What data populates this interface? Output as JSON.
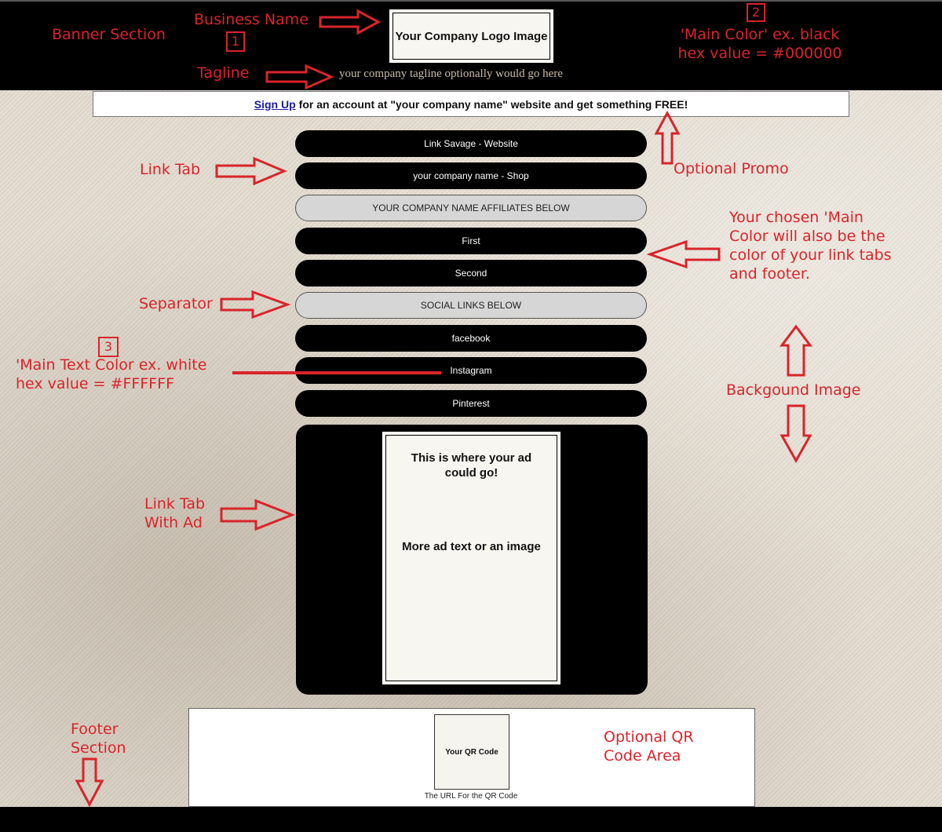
{
  "banner": {
    "logo_text": "Your Company Logo Image",
    "tagline": "your company tagline optionally would go here"
  },
  "promo": {
    "link_label": "Sign Up",
    "text": "for an account at \"your company name\" website and get something FREE!"
  },
  "link_tabs": [
    {
      "label": "Link Savage - Website",
      "type": "link"
    },
    {
      "label": "your company name - Shop",
      "type": "link"
    },
    {
      "label": "YOUR COMPANY NAME AFFILIATES BELOW",
      "type": "separator"
    },
    {
      "label": "First",
      "type": "link"
    },
    {
      "label": "Second",
      "type": "link"
    },
    {
      "label": "SOCIAL LINKS BELOW",
      "type": "separator"
    },
    {
      "label": "facebook",
      "type": "link"
    },
    {
      "label": "Instagram",
      "type": "link"
    },
    {
      "label": "Pinterest",
      "type": "link"
    }
  ],
  "ad": {
    "line1": "This is where your ad could go!",
    "line2": "More ad text or an image"
  },
  "footer": {
    "qr_label": "Your QR Code",
    "qr_url": "The URL For the QR Code"
  },
  "colors": {
    "main_color": "#000000",
    "main_text_color": "#FFFFFF",
    "annotation_color": "#d9242b"
  },
  "annotations": {
    "banner_section": "Banner Section",
    "business_name": "Business Name",
    "num1": "1",
    "tagline": "Tagline",
    "num2": "2",
    "main_color_line1": "'Main Color' ex. black",
    "main_color_line2": "hex value = #000000",
    "optional_promo": "Optional Promo",
    "link_tab": "Link Tab",
    "chosen_color_line1": "Your chosen 'Main",
    "chosen_color_line2": "Color will also be the",
    "chosen_color_line3": "color of your link tabs",
    "chosen_color_line4": "and footer.",
    "separator": "Separator",
    "num3": "3",
    "main_text_line1": "'Main Text Color ex. white",
    "main_text_line2": "hex value = #FFFFFF",
    "background_image": "Backgound Image",
    "link_tab_ad_line1": "Link Tab",
    "link_tab_ad_line2": "With Ad",
    "footer_line1": "Footer",
    "footer_line2": "Section",
    "qr_line1": "Optional QR",
    "qr_line2": "Code Area"
  }
}
